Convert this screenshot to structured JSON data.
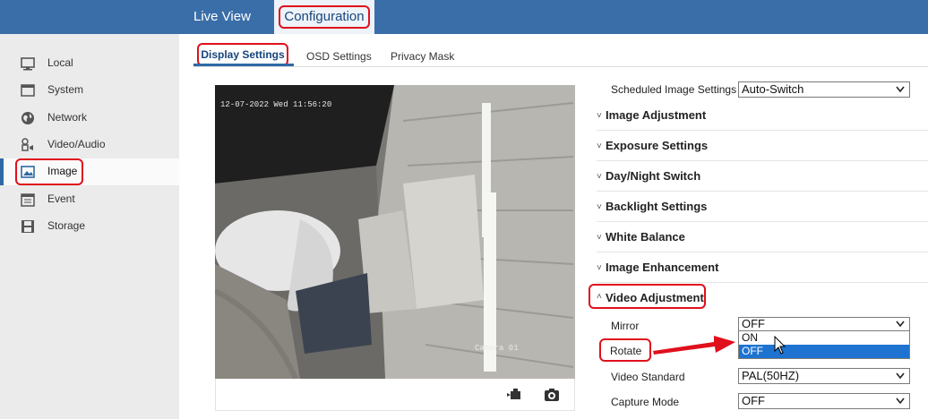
{
  "top_nav": {
    "live_view": "Live View",
    "configuration": "Configuration"
  },
  "sidebar": {
    "items": [
      {
        "label": "Local",
        "icon": "monitor-icon"
      },
      {
        "label": "System",
        "icon": "window-icon"
      },
      {
        "label": "Network",
        "icon": "globe-icon"
      },
      {
        "label": "Video/Audio",
        "icon": "video-audio-icon"
      },
      {
        "label": "Image",
        "icon": "image-icon",
        "active": true
      },
      {
        "label": "Event",
        "icon": "calendar-icon"
      },
      {
        "label": "Storage",
        "icon": "floppy-icon"
      }
    ]
  },
  "tabs": {
    "display": "Display Settings",
    "osd": "OSD Settings",
    "privacy": "Privacy Mask"
  },
  "video": {
    "timestamp": "12-07-2022 Wed 11:56:20",
    "camera_name": "Camera 01"
  },
  "settings": {
    "scheduled_label": "Scheduled Image Settings",
    "scheduled_value": "Auto-Switch",
    "sections": [
      "Image Adjustment",
      "Exposure Settings",
      "Day/Night Switch",
      "Backlight Settings",
      "White Balance",
      "Image Enhancement",
      "Video Adjustment"
    ],
    "mirror_label": "Mirror",
    "mirror_value": "OFF",
    "mirror_options": [
      "ON",
      "OFF"
    ],
    "rotate_label": "Rotate",
    "video_standard_label": "Video Standard",
    "video_standard_value": "PAL(50HZ)",
    "capture_mode_label": "Capture Mode",
    "capture_mode_value": "OFF"
  },
  "colors": {
    "accent": "#3a6ea8",
    "highlight": "#e0101c",
    "selected_option": "#1e73d0"
  }
}
